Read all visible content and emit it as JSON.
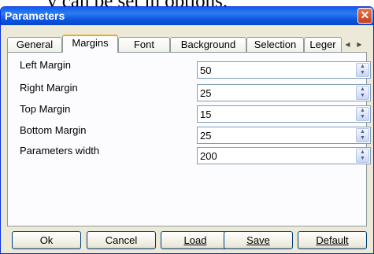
{
  "background_text": "v can be set in options.",
  "window": {
    "title": "Parameters",
    "close_glyph": "✕"
  },
  "tabs": [
    {
      "label": "General",
      "active": false
    },
    {
      "label": "Margins",
      "active": true
    },
    {
      "label": "Font",
      "active": false
    },
    {
      "label": "Background",
      "active": false
    },
    {
      "label": "Selection",
      "active": false
    },
    {
      "label": "Leger",
      "active": false
    }
  ],
  "tab_scroll": {
    "left_icon": "triangle-left-icon",
    "right_icon": "triangle-right-icon"
  },
  "fields": [
    {
      "label": "Left Margin",
      "value": "50"
    },
    {
      "label": "Right Margin",
      "value": "25"
    },
    {
      "label": "Top Margin",
      "value": "15"
    },
    {
      "label": "Bottom Margin",
      "value": "25"
    },
    {
      "label": "Parameters width",
      "value": "200"
    }
  ],
  "buttons": {
    "ok": "Ok",
    "cancel": "Cancel",
    "load": "Load",
    "save": "Save",
    "default": "Default"
  },
  "colors": {
    "title_bar": "#0a5ff0",
    "window_face": "#ece9d8",
    "active_tab_accent": "#f5a623",
    "close_button": "#c63f1f"
  }
}
